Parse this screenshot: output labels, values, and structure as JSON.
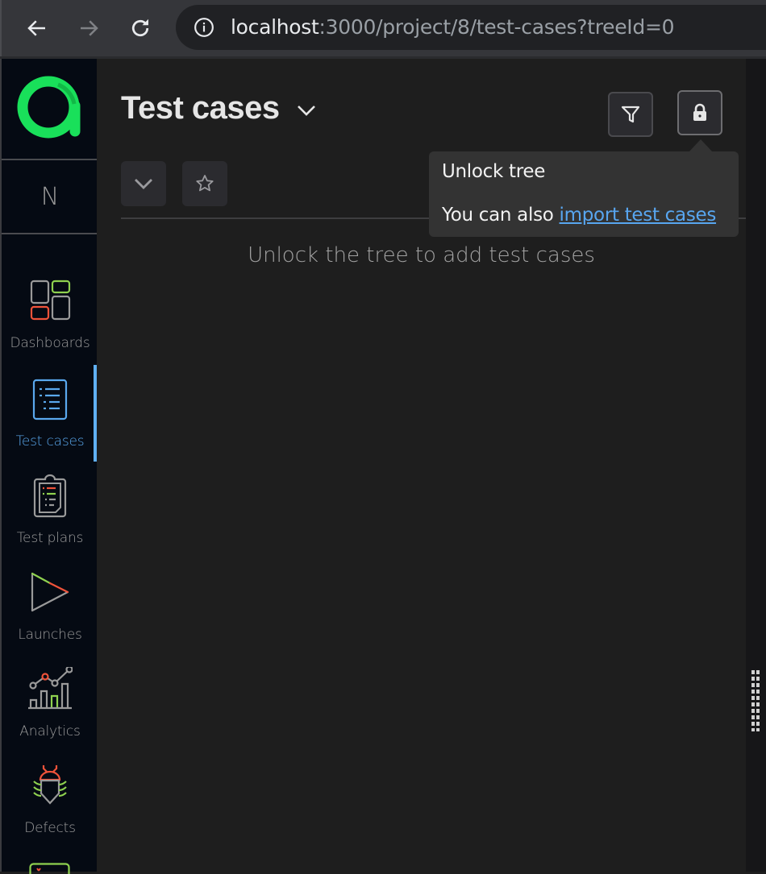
{
  "browser": {
    "url_host": "localhost",
    "url_rest": ":3000/project/8/test-cases?treeId=0"
  },
  "sidebar": {
    "project_letter": "N",
    "items": [
      {
        "label": "Dashboards",
        "icon": "dashboards-icon",
        "active": false
      },
      {
        "label": "Test cases",
        "icon": "test-cases-icon",
        "active": true
      },
      {
        "label": "Test plans",
        "icon": "test-plans-icon",
        "active": false
      },
      {
        "label": "Launches",
        "icon": "launches-icon",
        "active": false
      },
      {
        "label": "Analytics",
        "icon": "analytics-icon",
        "active": false
      },
      {
        "label": "Defects",
        "icon": "defects-icon",
        "active": false
      }
    ]
  },
  "header": {
    "title": "Test cases"
  },
  "empty_state": {
    "message": "Unlock the tree to add test cases"
  },
  "tooltip": {
    "title": "Unlock tree",
    "prefix": "You can also ",
    "link": "import test cases"
  },
  "colors": {
    "brand_green": "#19e05a",
    "accent_blue": "#60b0f4",
    "link_blue": "#58a6f0",
    "icon_red": "#f0533a",
    "icon_green": "#8fd14f"
  }
}
